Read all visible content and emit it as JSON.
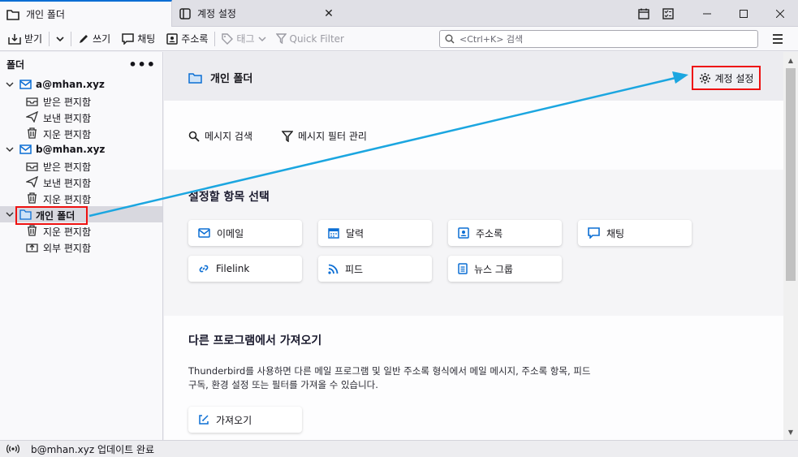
{
  "tabs": [
    {
      "label": "개인 폴더",
      "icon": "folder-icon",
      "active": true
    },
    {
      "label": "계정 설정",
      "icon": "settings-tab-icon",
      "active": false
    }
  ],
  "toolbar": {
    "get_messages": "받기",
    "write": "쓰기",
    "chat": "채팅",
    "address_book": "주소록",
    "tag": "태그",
    "quick_filter": "Quick Filter",
    "search_placeholder": "<Ctrl+K> 검색"
  },
  "folder_pane": {
    "header": "폴더",
    "more": "•••",
    "accounts": [
      {
        "name": "a@mhan.xyz",
        "folders": [
          "받은 편지함",
          "보낸 편지함",
          "지운 편지함"
        ]
      },
      {
        "name": "b@mhan.xyz",
        "folders": [
          "받은 편지함",
          "보낸 편지함",
          "지운 편지함"
        ]
      }
    ],
    "local": {
      "name": "개인 폴더",
      "folders": [
        "지운 편지함",
        "외부 편지함"
      ]
    }
  },
  "main": {
    "title": "개인 폴더",
    "account_settings": "계정 설정",
    "actions": {
      "search_messages": "메시지 검색",
      "manage_filters": "메시지 필터 관리"
    },
    "setup_title": "설정할 항목 선택",
    "setup_items": [
      "이메일",
      "달력",
      "주소록",
      "채팅",
      "Filelink",
      "피드",
      "뉴스 그룹"
    ],
    "import_title": "다른 프로그램에서 가져오기",
    "import_desc_1": "Thunderbird를 사용하면 다른 메일 프로그램 및 일반 주소록 형식에서 메일 메시지, 주소록 항목, 피드",
    "import_desc_2": "구독, 환경 설정 또는 필터를 가져올 수 있습니다.",
    "import_button": "가져오기"
  },
  "status": {
    "text": "b@mhan.xyz 업데이트 완료"
  },
  "colors": {
    "accent": "#0b6ed4",
    "annotation_red": "#e11111",
    "arrow_blue": "#1ba6e0"
  }
}
